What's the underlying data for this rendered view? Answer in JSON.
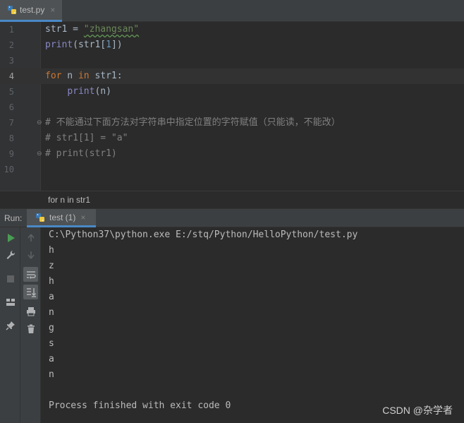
{
  "editor_tab": {
    "name": "test.py",
    "close": "×"
  },
  "code_lines": [
    {
      "num": "1",
      "tokens": [
        {
          "t": "str1 = ",
          "c": "pl"
        },
        {
          "t": "\"zhangsan\"",
          "c": "str squig"
        }
      ]
    },
    {
      "num": "2",
      "tokens": [
        {
          "t": "print",
          "c": "bi"
        },
        {
          "t": "(str1[",
          "c": "pl"
        },
        {
          "t": "1",
          "c": "num"
        },
        {
          "t": "])",
          "c": "pl"
        }
      ]
    },
    {
      "num": "3",
      "tokens": []
    },
    {
      "num": "4",
      "tokens": [
        {
          "t": "for",
          "c": "kw"
        },
        {
          "t": " n ",
          "c": "pl"
        },
        {
          "t": "in",
          "c": "kw"
        },
        {
          "t": " str1:",
          "c": "pl"
        }
      ]
    },
    {
      "num": "5",
      "tokens": [
        {
          "t": "    ",
          "c": "pl"
        },
        {
          "t": "print",
          "c": "bi"
        },
        {
          "t": "(n)",
          "c": "pl"
        }
      ]
    },
    {
      "num": "6",
      "tokens": []
    },
    {
      "num": "7",
      "tokens": [
        {
          "t": "# 不能通过下面方法对字符串中指定位置的字符赋值（只能读，不能改）",
          "c": "cm"
        }
      ]
    },
    {
      "num": "8",
      "tokens": [
        {
          "t": "# str1[1] = \"a\"",
          "c": "cm"
        }
      ]
    },
    {
      "num": "9",
      "tokens": [
        {
          "t": "# print(str1)",
          "c": "cm"
        }
      ]
    },
    {
      "num": "10",
      "tokens": []
    }
  ],
  "breadcrumb": "for n in str1",
  "run": {
    "label": "Run:",
    "tab_name": "test (1)",
    "tab_close": "×"
  },
  "console_lines": [
    "C:\\Python37\\python.exe E:/stq/Python/HelloPython/test.py",
    "h",
    "z",
    "h",
    "a",
    "n",
    "g",
    "s",
    "a",
    "n",
    "",
    "Process finished with exit code 0"
  ],
  "watermark": "CSDN @杂学者",
  "colors": {
    "accent": "#4a88c7",
    "run_green": "#499c54",
    "keyword": "#cc7832",
    "string": "#6a8759"
  },
  "left_toolbar_icons": [
    "run-icon",
    "wrench-icon",
    "stop-icon",
    "layout-icon",
    "pin-icon"
  ],
  "right_toolbar_icons": [
    "arrow-up-icon",
    "arrow-down-icon",
    "soft-wrap-icon",
    "scroll-to-end-icon",
    "print-icon",
    "trash-icon"
  ]
}
